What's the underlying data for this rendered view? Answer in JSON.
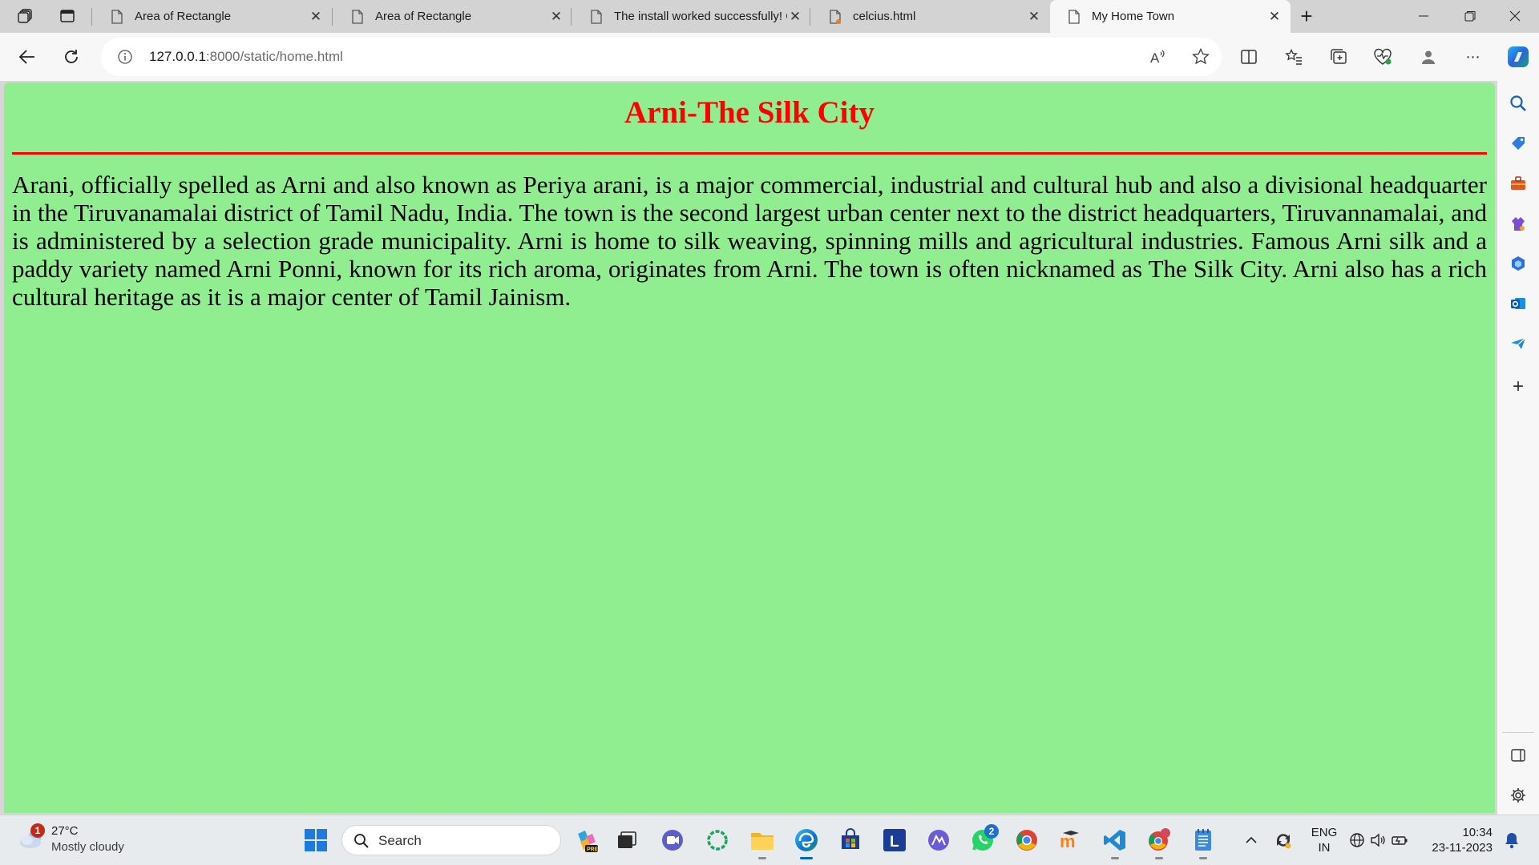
{
  "browser": {
    "tabs": [
      {
        "title": "Area of Rectangle",
        "active": false
      },
      {
        "title": "Area of Rectangle",
        "active": false
      },
      {
        "title": "The install worked successfully! C",
        "active": false
      },
      {
        "title": "celcius.html",
        "active": false
      },
      {
        "title": "My Home Town",
        "active": true
      }
    ],
    "address": {
      "host": "127.0.0.1",
      "path": ":8000/static/home.html"
    }
  },
  "page": {
    "heading": "Arni-The Silk City",
    "paragraph": "Arani, officially spelled as Arni and also known as Periya arani, is a major commercial, industrial and cultural hub and also a divisional headquarter in the Tiruvanamalai district of Tamil Nadu, India. The town is the second largest urban center next to the district headquarters, Tiruvannamalai, and is administered by a selection grade municipality. Arni is home to silk weaving, spinning mills and agricultural industries. Famous Arni silk and a paddy variety named Arni Ponni, known for its rich aroma, originates from Arni. The town is often nicknamed as The Silk City. Arni also has a rich cultural heritage as it is a major center of Tamil Jainism.",
    "background_color": "#90ee90",
    "heading_color": "#ff0000"
  },
  "taskbar": {
    "weather": {
      "temp": "27°C",
      "condition": "Mostly cloudy",
      "badge": "1"
    },
    "search_label": "Search",
    "whatsapp_badge": "2",
    "language": {
      "lang": "ENG",
      "region": "IN"
    },
    "clock": {
      "time": "10:34",
      "date": "23-11-2023"
    }
  },
  "icons": {
    "tab_actions": "tab-actions-icon",
    "vertical_tabs": "vertical-tabs-icon",
    "page": "page-icon",
    "back": "back-arrow-icon",
    "refresh": "refresh-icon",
    "site_info": "info-icon",
    "read_aloud": "read-aloud-icon",
    "favorite": "star-icon",
    "copilot": "copilot-icon"
  }
}
